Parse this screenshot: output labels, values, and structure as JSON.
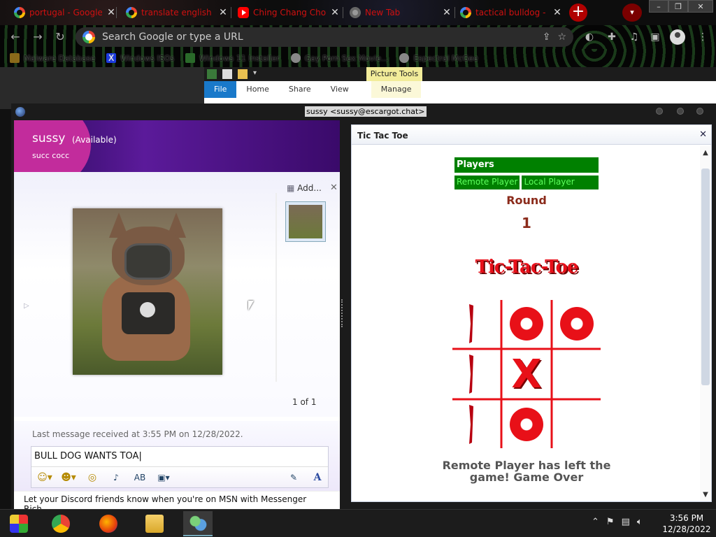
{
  "browser": {
    "tabs": [
      {
        "title": "portugal - Google",
        "icon": "google-icon"
      },
      {
        "title": "translate english",
        "icon": "google-icon"
      },
      {
        "title": "Ching Chang Chong",
        "icon": "youtube-icon"
      },
      {
        "title": "New Tab",
        "icon": "chrome-icon"
      },
      {
        "title": "tactical bulldog -",
        "icon": "google-icon"
      }
    ],
    "omnibox_placeholder": "Search Google or type a URL",
    "bookmarks": [
      {
        "label": "Malware Database",
        "color": "#8a6a1a"
      },
      {
        "label": "Windows ISOs",
        "color": "#1a3ae0"
      },
      {
        "label": "Windows 11 Installer",
        "color": "#2a6a2a"
      },
      {
        "label": "Gay Porn Sex Movie...",
        "color": "#888888"
      },
      {
        "label": "Espectral McGee",
        "color": "#888888"
      }
    ]
  },
  "explorer": {
    "contextual_tab": "Picture Tools",
    "ribbon_tabs": [
      "File",
      "Home",
      "Share",
      "View"
    ],
    "manage_tab": "Manage"
  },
  "messenger": {
    "window_title": "sussy <sussy@escargot.chat>",
    "contact": {
      "name": "sussy",
      "status": "(Available)",
      "personal_message": "succ cocc"
    },
    "share": {
      "add_label": "Add...",
      "counter": "1 of 1"
    },
    "last_message": "Last message received at 3:55 PM on 12/28/2022.",
    "compose_text": "BULL DOG WANTS TOA",
    "status_bar": "Let your Discord friends know when you're on MSN with Messenger Rich..."
  },
  "game": {
    "title": "Tic Tac Toe",
    "players_header": "Players",
    "players": [
      "Remote Player",
      "Local Player"
    ],
    "round_label": "Round",
    "round_number": "1",
    "logo_text": "Tic-Tac-Toe",
    "board": [
      "",
      "O",
      "O",
      "",
      "X",
      "",
      "",
      "O",
      ""
    ],
    "status_message": "Remote Player has left the game! Game Over",
    "colors": {
      "green": "#008000",
      "red": "#e81018",
      "round": "#8b2b1b"
    }
  },
  "taskbar": {
    "time": "3:56 PM",
    "date": "12/28/2022"
  }
}
